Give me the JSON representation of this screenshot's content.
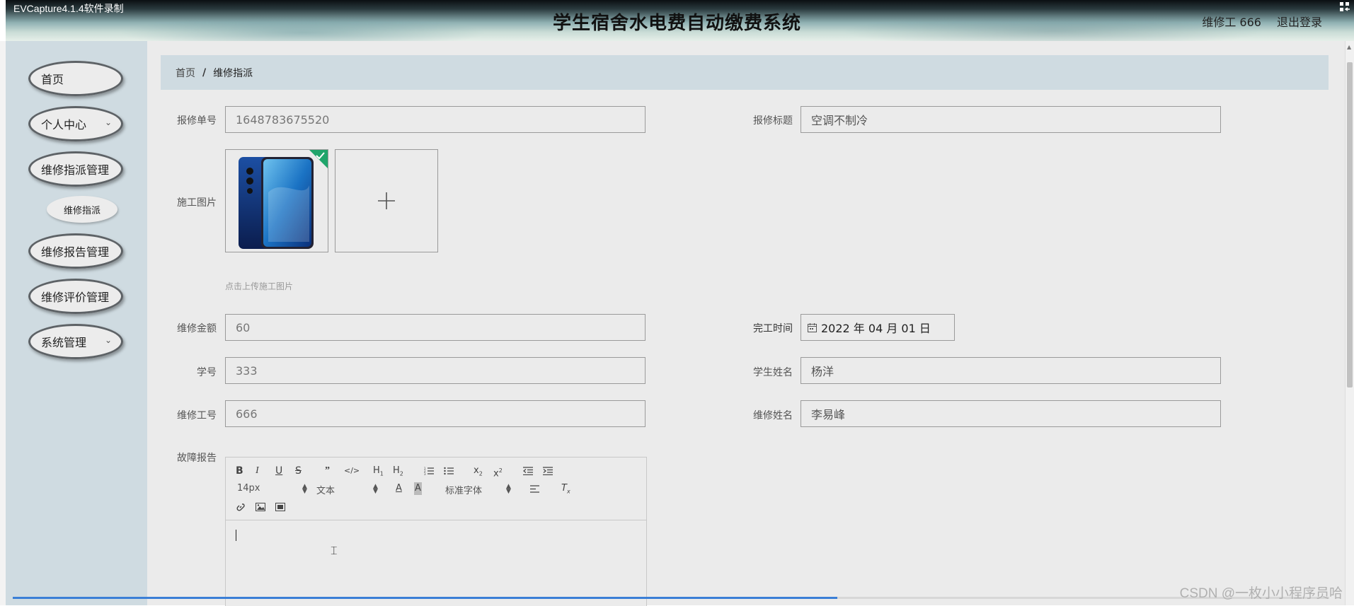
{
  "recorder_label": "EVCapture4.1.4软件录制",
  "header": {
    "title": "学生宿舍水电费自动缴费系统",
    "user": "维修工 666",
    "logout": "退出登录"
  },
  "sidebar": {
    "items": [
      {
        "label": "首页"
      },
      {
        "label": "个人中心"
      },
      {
        "label": "维修指派管理"
      },
      {
        "label": "维修报告管理"
      },
      {
        "label": "维修评价管理"
      },
      {
        "label": "系统管理"
      }
    ],
    "sub_item": "维修指派"
  },
  "breadcrumb": {
    "home": "首页",
    "sep": "/",
    "current": "维修指派"
  },
  "form": {
    "repair_no_label": "报修单号",
    "repair_no": "1648783675520",
    "repair_title_label": "报修标题",
    "repair_title": "空调不制冷",
    "image_label": "施工图片",
    "upload_hint": "点击上传施工图片",
    "amount_label": "维修金额",
    "amount": "60",
    "finish_time_label": "完工时间",
    "finish_time": "2022 年 04 月 01 日",
    "student_id_label": "学号",
    "student_id": "333",
    "student_name_label": "学生姓名",
    "student_name": "杨洋",
    "worker_id_label": "维修工号",
    "worker_id": "666",
    "worker_name_label": "维修姓名",
    "worker_name": "李易峰",
    "report_label": "故障报告"
  },
  "editor": {
    "font_size": "14px",
    "heading": "文本",
    "font_family": "标准字体"
  },
  "watermark": "CSDN @一枚小小程序员哈"
}
